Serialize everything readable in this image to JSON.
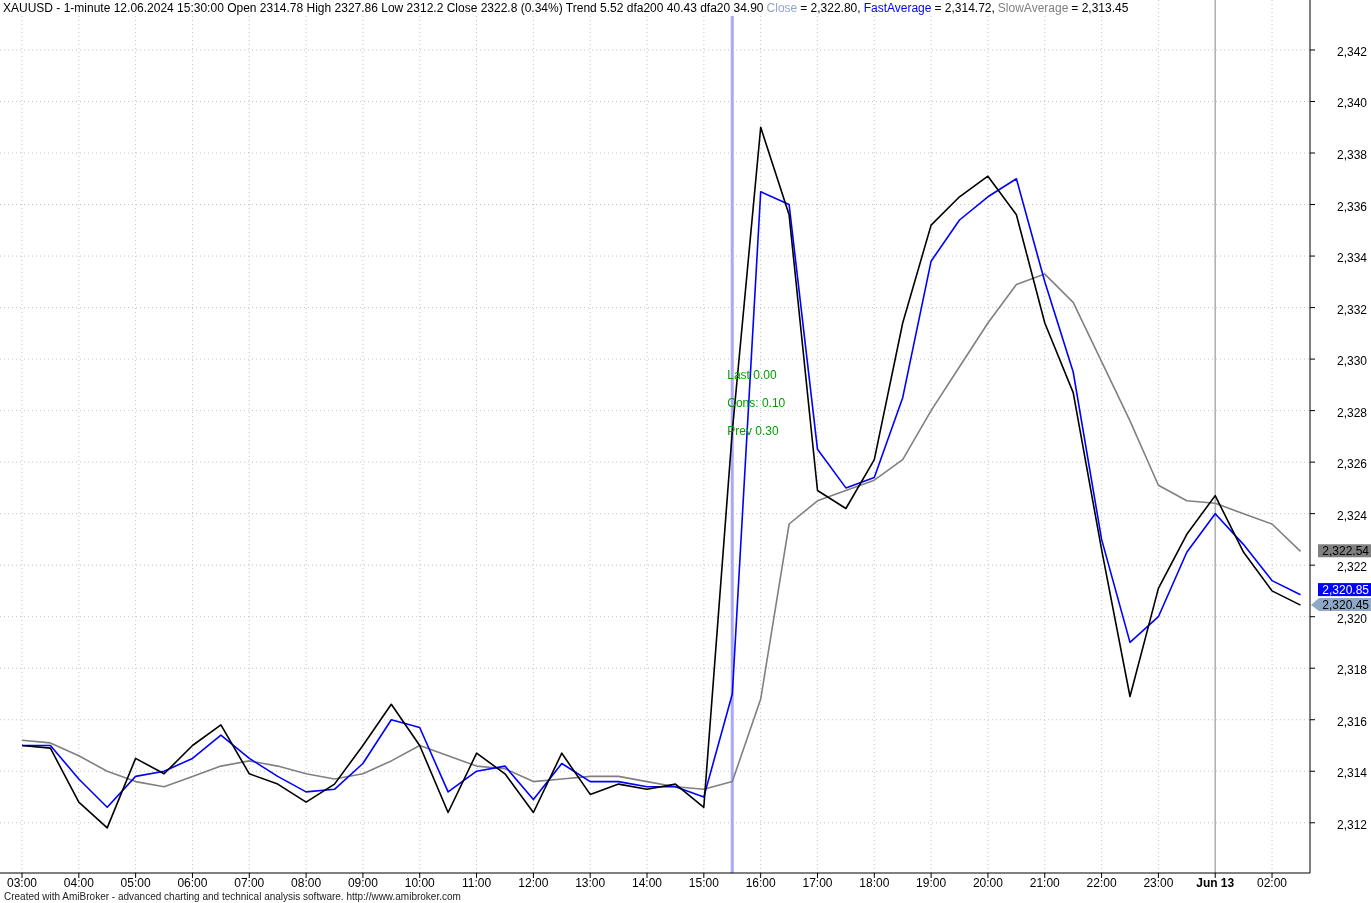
{
  "header": {
    "title": "XAUUSD - 1-minute 12.06.2024 15:30:00 Open 2314.78 High 2327.86 Low 2312.2 Close 2322.8 (0.34%) Trend 5.52 dfa200 40.43 dfa20 34.90",
    "legend": [
      {
        "reading": "= 2,322.80,",
        "color": "#8ea6c8"
      },
      {
        "reading": "= 2,314.72,",
        "color": "#0000ff"
      },
      {
        "reading": "= 2,313.45",
        "color": "#808080"
      }
    ]
  },
  "chart": {
    "chart_data": {
      "type": "line",
      "categories": [
        "03:00",
        null,
        "04:00",
        null,
        "05:00",
        null,
        "06:00",
        null,
        "07:00",
        null,
        "08:00",
        null,
        "09:00",
        null,
        "10:00",
        null,
        "11:00",
        null,
        "12:00",
        null,
        "13:00",
        null,
        "14:00",
        null,
        "15:00",
        null,
        "16:00",
        null,
        "17:00",
        null,
        "18:00",
        null,
        "19:00",
        null,
        "20:00",
        null,
        "21:00",
        null,
        "22:00",
        null,
        "23:00",
        null,
        "Jun 13",
        null,
        "02:00",
        null
      ],
      "series": [
        {
          "name": "Close",
          "color": "#000000",
          "values": [
            2315.0,
            2314.9,
            2312.8,
            2311.8,
            2314.5,
            2313.9,
            2315.0,
            2315.8,
            2313.9,
            2313.5,
            2312.8,
            2313.5,
            2315.0,
            2316.6,
            2315.0,
            2312.4,
            2314.7,
            2313.9,
            2312.4,
            2314.7,
            2313.1,
            2313.5,
            2313.3,
            2313.5,
            2312.6,
            2327.2,
            2339.0,
            2335.6,
            2324.9,
            2324.2,
            2326.1,
            2331.4,
            2335.2,
            2336.3,
            2337.1,
            2335.6,
            2331.4,
            2328.7,
            2322.6,
            2316.9,
            2321.1,
            2323.2,
            2324.7,
            2322.5,
            2321.0,
            2320.45
          ]
        },
        {
          "name": "FastAverage",
          "color": "#0000ff",
          "values": [
            2315.0,
            2315.0,
            2313.7,
            2312.6,
            2313.8,
            2314.0,
            2314.5,
            2315.4,
            2314.5,
            2313.8,
            2313.2,
            2313.3,
            2314.3,
            2316.0,
            2315.7,
            2313.2,
            2314.0,
            2314.2,
            2312.9,
            2314.3,
            2313.6,
            2313.6,
            2313.4,
            2313.4,
            2313.0,
            2317.0,
            2336.5,
            2336.0,
            2326.5,
            2325.0,
            2325.4,
            2328.5,
            2333.8,
            2335.4,
            2336.3,
            2337.0,
            2333.0,
            2329.5,
            2323.0,
            2319.0,
            2320.0,
            2322.5,
            2324.0,
            2322.8,
            2321.4,
            2320.85
          ]
        },
        {
          "name": "SlowAverage",
          "color": "#808080",
          "values": [
            2315.2,
            2315.1,
            2314.6,
            2314.0,
            2313.6,
            2313.4,
            2313.8,
            2314.2,
            2314.4,
            2314.2,
            2313.9,
            2313.7,
            2313.9,
            2314.4,
            2315.0,
            2314.6,
            2314.2,
            2314.1,
            2313.6,
            2313.7,
            2313.8,
            2313.8,
            2313.6,
            2313.4,
            2313.3,
            2313.6,
            2316.8,
            2323.6,
            2324.5,
            2324.9,
            2325.3,
            2326.1,
            2328.0,
            2329.7,
            2331.4,
            2332.9,
            2333.3,
            2332.2,
            2329.9,
            2327.6,
            2325.1,
            2324.5,
            2324.4,
            2324.0,
            2323.6,
            2322.54
          ]
        }
      ],
      "ylim": [
        2310.05,
        2343.94
      ],
      "yticks": [
        {
          "value": 2312,
          "label": "2,312"
        },
        {
          "value": 2314,
          "label": "2,314"
        },
        {
          "value": 2316,
          "label": "2,316"
        },
        {
          "value": 2318,
          "label": "2,318"
        },
        {
          "value": 2320,
          "label": "2,320"
        },
        {
          "value": 2322,
          "label": "2,322"
        },
        {
          "value": 2324,
          "label": "2,324"
        },
        {
          "value": 2326,
          "label": "2,326"
        },
        {
          "value": 2328,
          "label": "2,328"
        },
        {
          "value": 2330,
          "label": "2,330"
        },
        {
          "value": 2332,
          "label": "2,332"
        },
        {
          "value": 2334,
          "label": "2,334"
        },
        {
          "value": 2336,
          "label": "2,336"
        },
        {
          "value": 2338,
          "label": "2,338"
        },
        {
          "value": 2340,
          "label": "2,340"
        },
        {
          "value": 2342,
          "label": "2,342"
        }
      ],
      "grid": true,
      "annotations": [
        "Last 0.00",
        "Cons: 0.10",
        "Prev 0.30"
      ]
    },
    "price_tags": [
      {
        "text": "2,322.54",
        "color": "#808080",
        "kind": "box"
      },
      {
        "text": "2,320.85",
        "color": "#0000ff",
        "kind": "box"
      },
      {
        "text": "2,320.45",
        "color": "#8fa8c8",
        "kind": "pointer"
      }
    ]
  },
  "footer": "Created with AmiBroker - advanced charting and technical analysis software. http://www.amibroker.com"
}
